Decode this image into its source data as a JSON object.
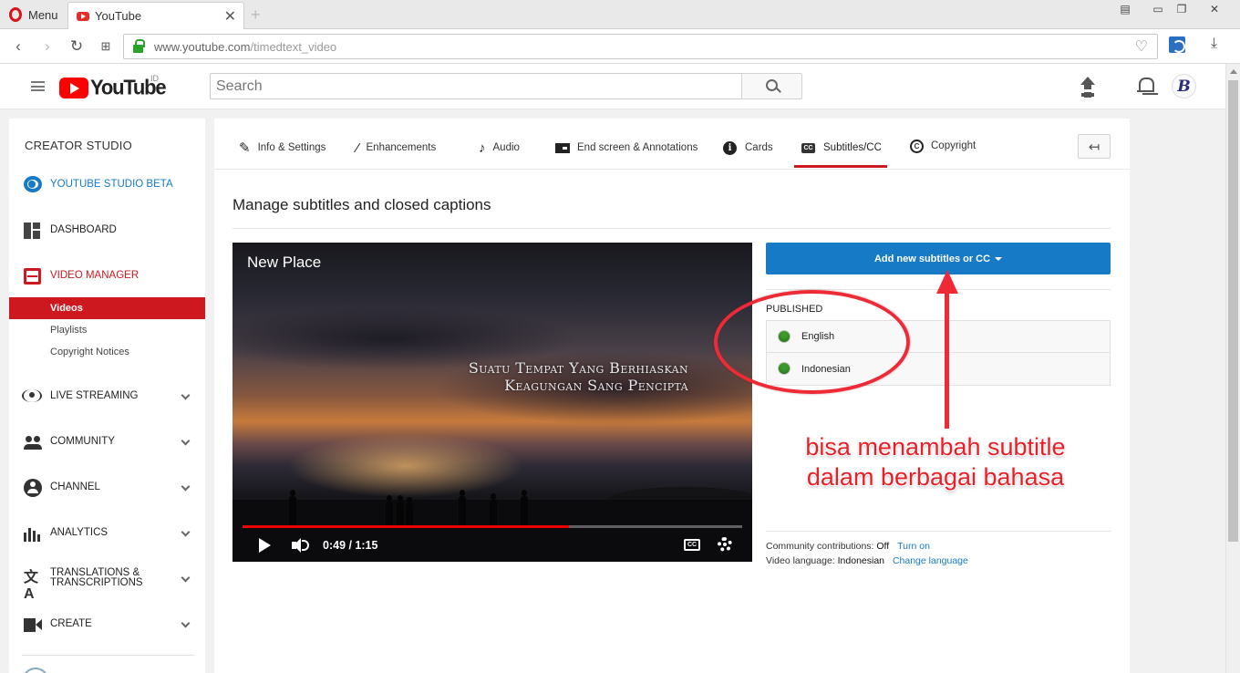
{
  "browser": {
    "menu_label": "Menu",
    "tab_title": "YouTube",
    "url_host": "www.youtube.com",
    "url_path": "/timedtext_video"
  },
  "masthead": {
    "logo_text": "YouTube",
    "country_code": "ID",
    "search_placeholder": "Search",
    "avatar_letter": "B"
  },
  "sidebar": {
    "title": "CREATOR STUDIO",
    "items": [
      {
        "label": "YOUTUBE STUDIO BETA",
        "icon": "gear-icon"
      },
      {
        "label": "DASHBOARD",
        "icon": "dashboard-icon"
      },
      {
        "label": "VIDEO MANAGER",
        "icon": "video-manager-icon"
      },
      {
        "label": "LIVE STREAMING",
        "icon": "live-icon"
      },
      {
        "label": "COMMUNITY",
        "icon": "community-icon"
      },
      {
        "label": "CHANNEL",
        "icon": "channel-icon"
      },
      {
        "label": "ANALYTICS",
        "icon": "analytics-icon"
      },
      {
        "label": "TRANSLATIONS & TRANSCRIPTIONS",
        "icon": "translate-icon"
      },
      {
        "label": "CREATE",
        "icon": "create-icon"
      }
    ],
    "sub_items": [
      "Videos",
      "Playlists",
      "Copyright Notices"
    ]
  },
  "tabs": [
    {
      "label": "Info & Settings",
      "icon": "pencil-icon"
    },
    {
      "label": "Enhancements",
      "icon": "magic-wand-icon"
    },
    {
      "label": "Audio",
      "icon": "music-note-icon"
    },
    {
      "label": "End screen & Annotations",
      "icon": "end-screen-icon"
    },
    {
      "label": "Cards",
      "icon": "info-icon"
    },
    {
      "label": "Subtitles/CC",
      "icon": "cc-icon"
    },
    {
      "label": "Copyright",
      "icon": "copyright-icon"
    }
  ],
  "active_tab": "Subtitles/CC",
  "page_title": "Manage subtitles and closed captions",
  "player": {
    "title": "New Place",
    "caption_line1": "Suatu Tempat Yang Berhiaskan",
    "caption_line2": "Keagungan Sang Pencipta",
    "time": "0:49 / 1:15",
    "progress_fraction": 0.653,
    "cc_label": "CC"
  },
  "subtitles": {
    "add_button": "Add new subtitles or CC",
    "published_label": "PUBLISHED",
    "languages": [
      "English",
      "Indonesian"
    ],
    "status_color": "#3c9a2a"
  },
  "meta": {
    "community_label": "Community contributions:",
    "community_value": "Off",
    "community_link": "Turn on",
    "language_label": "Video language:",
    "language_value": "Indonesian",
    "language_link": "Change language"
  },
  "annotation": {
    "line1": "bisa menambah subtitle",
    "line2": "dalam berbagai bahasa",
    "color": "#ee2a36"
  },
  "colors": {
    "accent_red": "#cc181e",
    "link_blue": "#167ac6",
    "button_blue": "#167ac6"
  }
}
